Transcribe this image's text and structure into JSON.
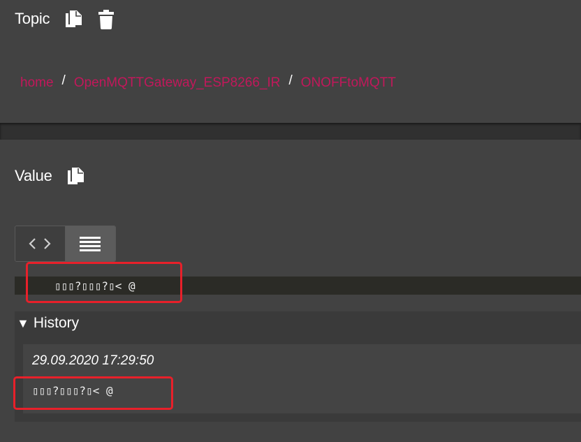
{
  "topic": {
    "title": "Topic",
    "breadcrumb": [
      "home",
      "OpenMQTTGateway_ESP8266_IR",
      "ONOFFtoMQTT"
    ],
    "separator": "/"
  },
  "value": {
    "title": "Value",
    "content": "▯▯▯?▯▯▯?▯< @"
  },
  "history": {
    "toggle_symbol": "▼",
    "label": "History",
    "items": [
      {
        "timestamp": "29.09.2020 17:29:50",
        "value": "▯▯▯?▯▯▯?▯< @"
      }
    ]
  },
  "colors": {
    "breadcrumb_link": "#c2185b",
    "highlight_border": "#e8202a",
    "panel_background": "#424242"
  },
  "icons": {
    "topic_copy": "copy-icon",
    "topic_delete": "trash-icon",
    "value_copy": "copy-icon",
    "view_raw": "code-icon",
    "view_text": "list-icon"
  }
}
